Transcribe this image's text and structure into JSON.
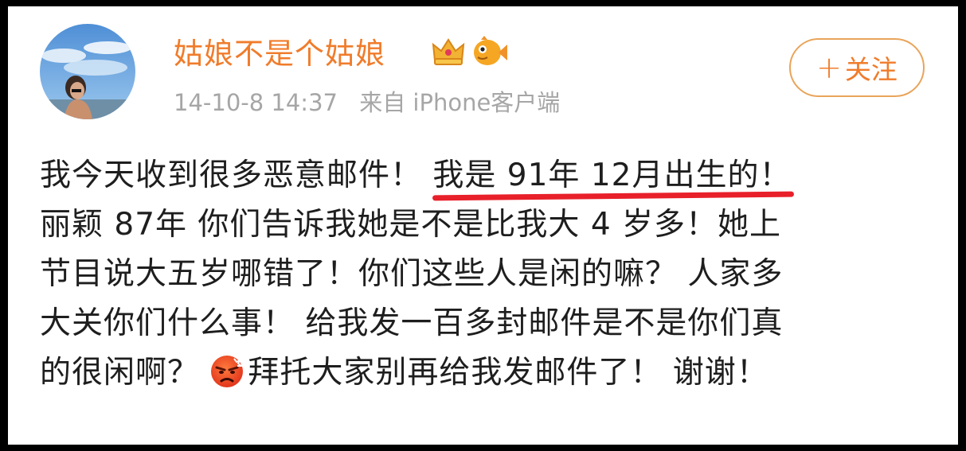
{
  "post": {
    "username": "姑娘不是个姑娘",
    "timestamp": "14-10-8 14:37",
    "source": "来自 iPhone客户端",
    "follow_label": "关注",
    "follow_plus": "+",
    "badges": [
      "crown-icon",
      "fish-icon"
    ],
    "body": {
      "line1_a": "我今天收到很多恶意邮件！ ",
      "line1_highlight": "我是 91年 12月出生的！",
      "line2": "丽颖 87年 你们告诉我她是不是比我大 4 岁多！她上",
      "line3": "节目说大五岁哪错了！你们这些人是闲的嘛？ 人家多",
      "line4": "大关你们什么事！ 给我发一百多封邮件是不是你们真",
      "line5_a": "的很闲啊？ ",
      "line5_emoji": "angry-face-icon",
      "line5_b": "拜托大家别再给我发邮件了！ 谢谢！"
    }
  },
  "colors": {
    "username": "#f07c2b",
    "meta": "#a6a6a6",
    "text": "#1e1e1e",
    "underline": "#e8202a",
    "follow_border": "#e9a45a"
  }
}
